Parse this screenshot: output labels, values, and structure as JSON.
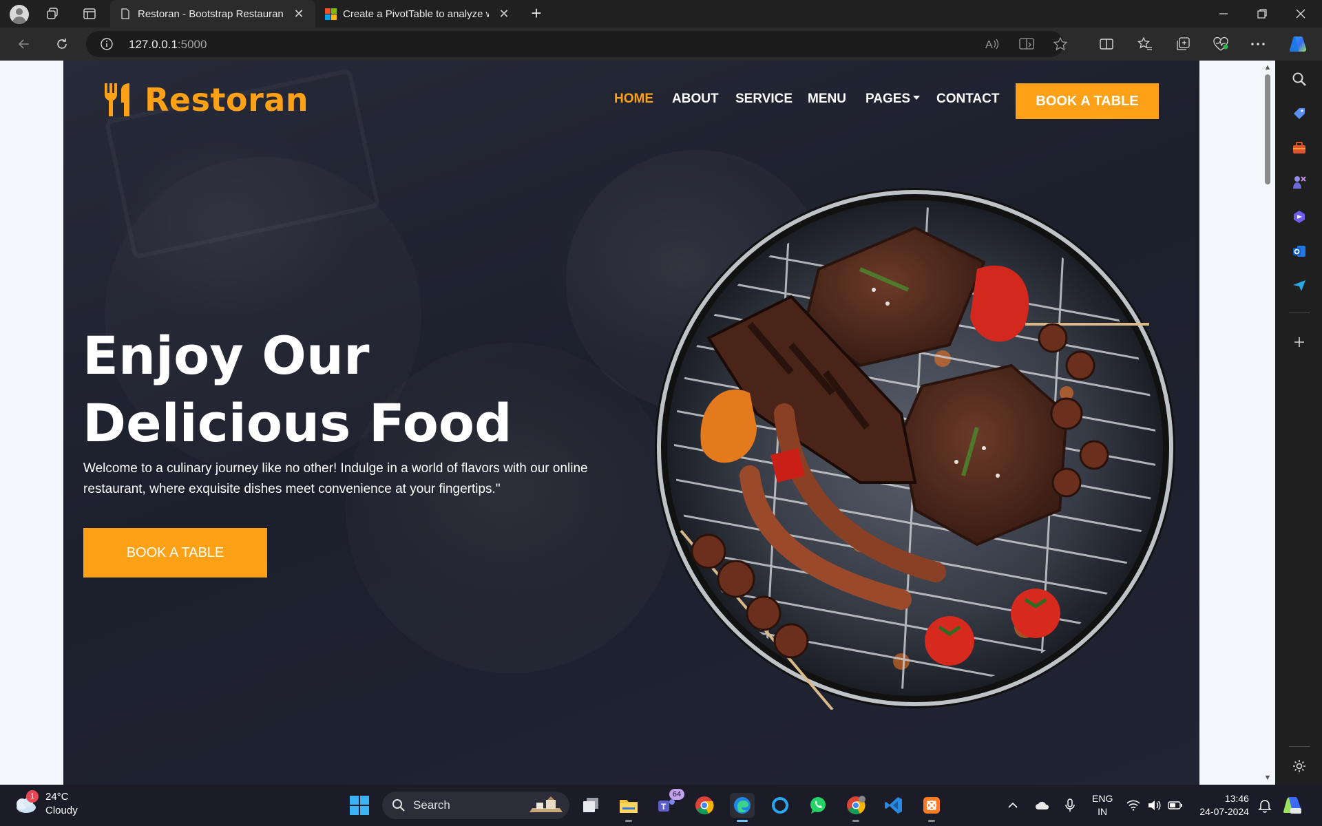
{
  "browser": {
    "tabs": [
      {
        "title": "Restoran - Bootstrap Restaurant",
        "close": "✕"
      },
      {
        "title": "Create a PivotTable to analyze w",
        "close": "✕"
      }
    ],
    "new_tab": "+",
    "url_host": "127.0.0.1",
    "url_port": ":5000"
  },
  "site": {
    "brand": "Restoran",
    "nav": {
      "home": "Home",
      "about": "About",
      "service": "Service",
      "menu": "Menu",
      "pages": "Pages",
      "contact": "Contact",
      "cta": "Book A Table"
    },
    "hero": {
      "title_line1": "Enjoy Our",
      "title_line2": "Delicious Food",
      "text": "Welcome to a culinary journey like no other! Indulge in a world of flavors with our online restaurant, where exquisite dishes meet convenience at your fingertips.\"",
      "button": "Book A Table"
    },
    "colors": {
      "primary": "#fea116",
      "dark": "#0f172b"
    }
  },
  "taskbar": {
    "weather": {
      "temp": "24°C",
      "condition": "Cloudy",
      "badge": "1"
    },
    "search_label": "Search",
    "teams_badge": "64",
    "lang_line1": "ENG",
    "lang_line2": "IN",
    "time": "13:46",
    "date": "24-07-2024"
  },
  "icons": {
    "tabstrip": [
      "profile-avatar",
      "workspaces-icon",
      "tab-actions-icon"
    ],
    "toolbar": [
      "back-icon",
      "refresh-icon",
      "info-icon",
      "read-aloud-icon",
      "immersive-reader-icon",
      "favorite-star-icon",
      "split-screen-icon",
      "favorites-icon",
      "collections-icon",
      "browser-essentials-icon",
      "more-icon",
      "copilot-icon"
    ],
    "sidebar": [
      "search-icon",
      "shopping-tag-icon",
      "tools-icon",
      "games-icon",
      "copilot-icon",
      "outlook-icon",
      "send-icon",
      "add-icon",
      "settings-icon"
    ]
  }
}
